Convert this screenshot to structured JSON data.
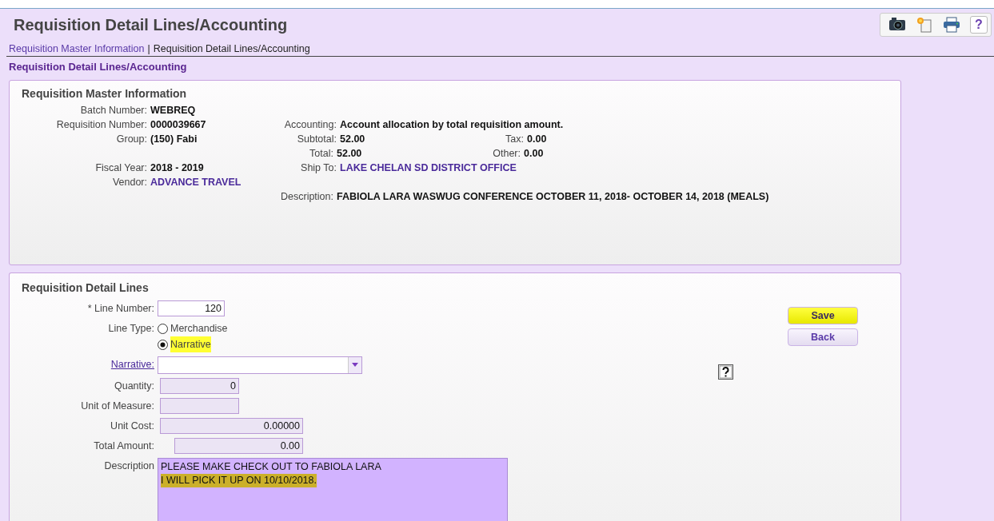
{
  "header": {
    "title": "Requisition Detail Lines/Accounting",
    "toolbar": [
      {
        "kind": "camera"
      },
      {
        "kind": "new"
      },
      {
        "kind": "print"
      },
      {
        "kind": "help",
        "label": "?"
      }
    ]
  },
  "breadcrumb": {
    "separator": "|",
    "items": [
      {
        "label": "Requisition Master Information",
        "link": true
      },
      {
        "label": "Requisition Detail Lines/Accounting",
        "link": false
      }
    ]
  },
  "section_title": "Requisition Detail Lines/Accounting",
  "master": {
    "title": "Requisition Master Information",
    "rows": [
      {
        "left": {
          "label": "Batch Number:",
          "value": "WEBREQ"
        }
      },
      {
        "left": {
          "label": "Requisition Number:",
          "value": "0000039667"
        },
        "middle": {
          "label": "Accounting:",
          "value": "Account allocation by total requisition amount."
        }
      },
      {
        "left": {
          "label": "Group:",
          "value": "(150) Fabi"
        },
        "middle": {
          "label": "Subtotal:",
          "value": "52.00"
        },
        "right": {
          "label": "Tax:",
          "value": "0.00"
        }
      },
      {
        "middle": {
          "label": "Total:",
          "value": "52.00"
        },
        "right": {
          "label": "Other:",
          "value": "0.00"
        }
      },
      {
        "left": {
          "label": "Fiscal Year:",
          "value": "2018 - 2019"
        },
        "middle": {
          "label": "Ship To:",
          "value": "LAKE CHELAN SD DISTRICT OFFICE",
          "link": true
        }
      },
      {
        "left": {
          "label": "Vendor:",
          "value": "ADVANCE TRAVEL",
          "link": true
        }
      },
      {
        "middle": {
          "label": "Description:",
          "value": "FABIOLA LARA WASWUG CONFERENCE OCTOBER 11, 2018- OCTOBER 14, 2018 (MEALS)"
        }
      }
    ]
  },
  "detail": {
    "title": "Requisition Detail Lines",
    "fields": [
      {
        "kind": "input",
        "label": "* Line Number:",
        "value": "120"
      },
      {
        "kind": "radio",
        "label": "Line Type:",
        "options": [
          {
            "label": "Merchandise",
            "selected": false,
            "highlighted": false
          },
          {
            "label": "Narrative",
            "selected": true,
            "highlighted": true
          }
        ]
      },
      {
        "kind": "select",
        "label": "Narrative:"
      },
      {
        "kind": "readonly",
        "label": "Quantity:",
        "value": "0"
      },
      {
        "kind": "readonly",
        "label": "Unit of Measure:"
      },
      {
        "kind": "readonly",
        "label": "Unit Cost:",
        "value": "0.00000"
      },
      {
        "kind": "readonly",
        "label": "Total Amount:",
        "value": "0.00"
      },
      {
        "kind": "textarea",
        "label": "Description",
        "lines": [
          {
            "text": "PLEASE MAKE CHECK OUT TO FABIOLA LARA",
            "highlighted": false
          },
          {
            "text": "I WILL PICK IT UP ON 10/10/2018.",
            "highlighted": true
          }
        ]
      }
    ],
    "buttons": [
      {
        "label": "Save",
        "highlighted": true
      },
      {
        "label": "Back",
        "highlighted": false
      }
    ]
  }
}
